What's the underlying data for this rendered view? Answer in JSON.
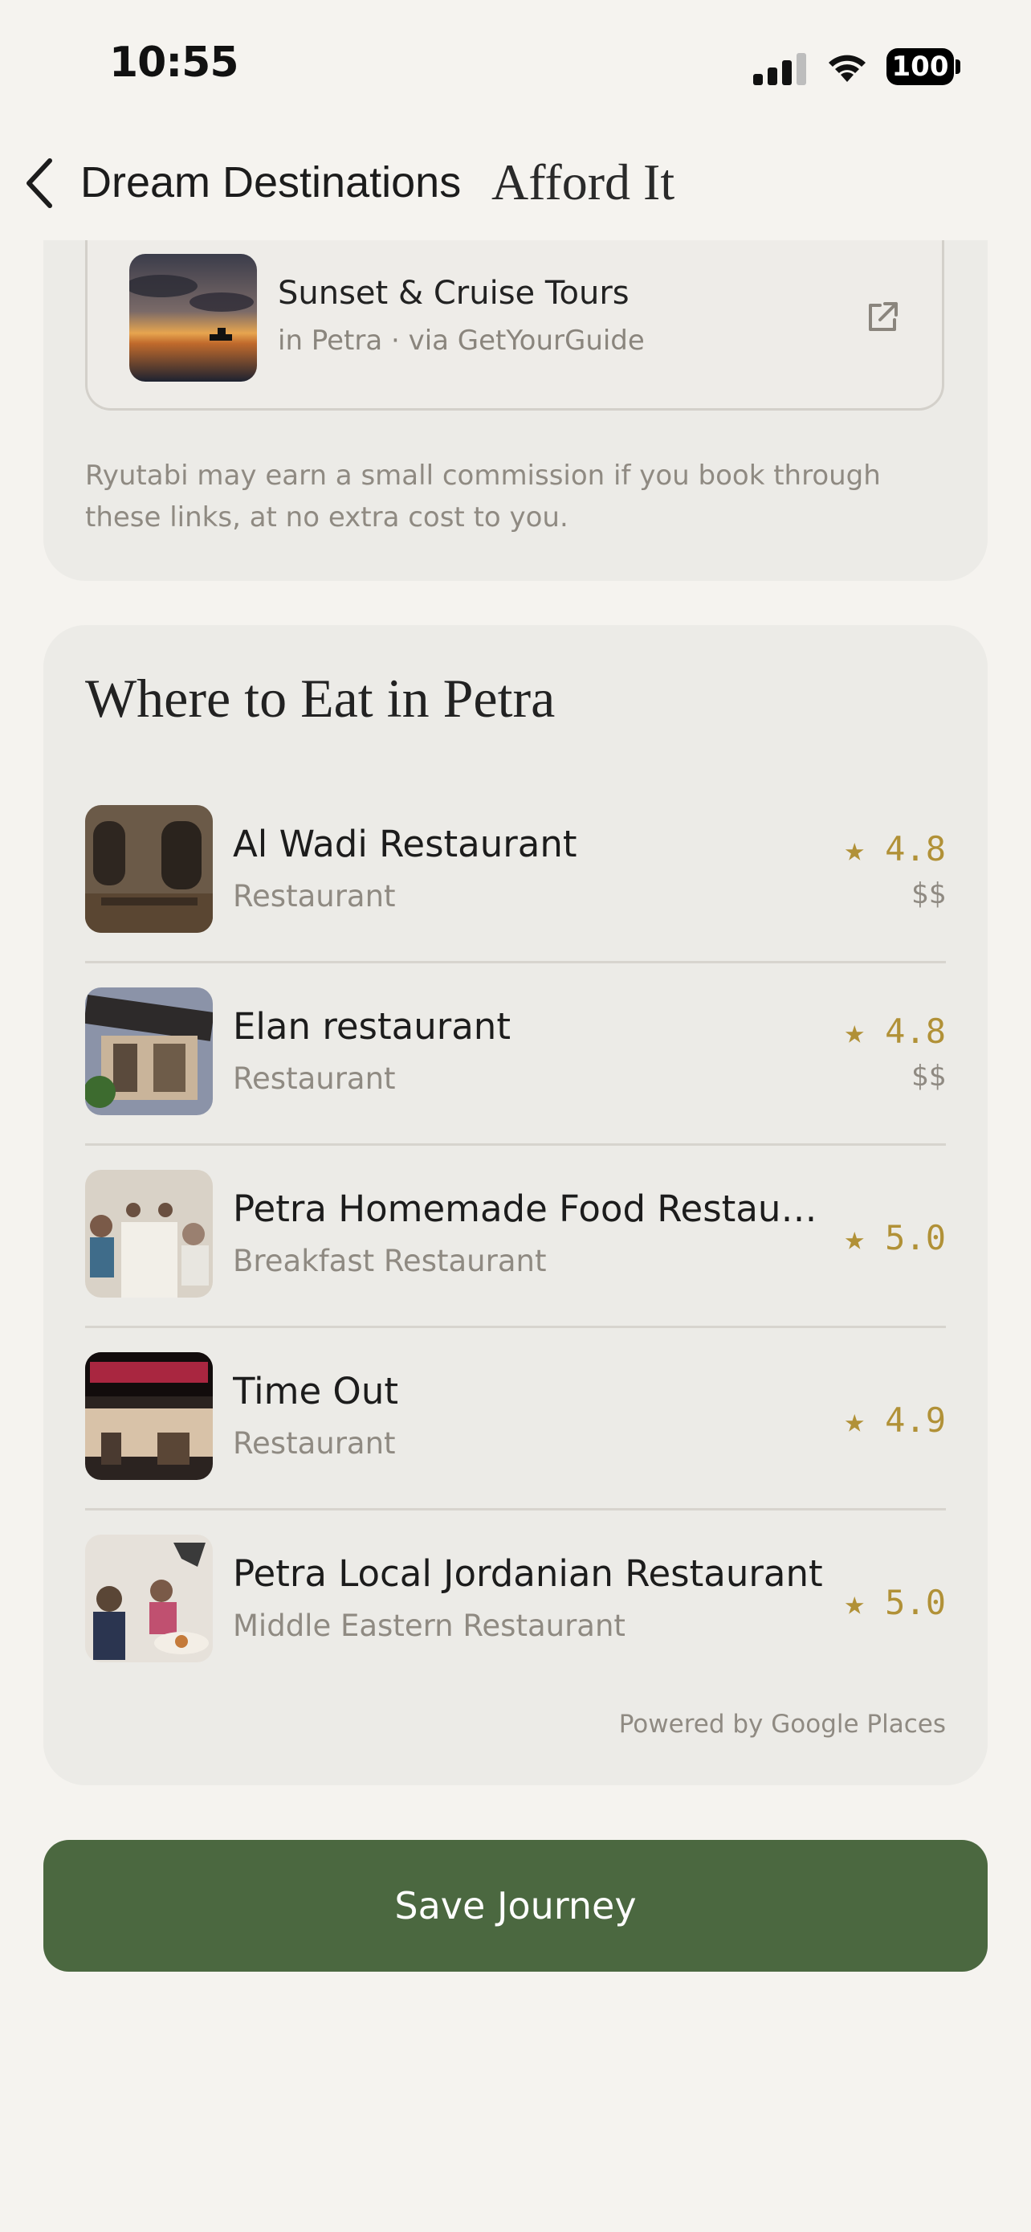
{
  "status_bar": {
    "time": "10:55",
    "battery": "100"
  },
  "nav": {
    "title": "Dream Destinations",
    "subtitle": "Afford It"
  },
  "tour": {
    "title": "Sunset & Cruise Tours",
    "subtitle": "in Petra · via GetYourGuide"
  },
  "disclaimer": "Ryutabi may earn a small commission if you book through these links, at no extra cost to you.",
  "eat": {
    "title": "Where to Eat in Petra",
    "restaurants": [
      {
        "name": "Al Wadi Restaurant",
        "category": "Restaurant",
        "rating": "★ 4.8",
        "price": "$$"
      },
      {
        "name": "Elan restaurant",
        "category": "Restaurant",
        "rating": "★ 4.8",
        "price": "$$"
      },
      {
        "name": "Petra Homemade Food Restaura...",
        "category": "Breakfast Restaurant",
        "rating": "★ 5.0",
        "price": ""
      },
      {
        "name": "Time Out",
        "category": "Restaurant",
        "rating": "★ 4.9",
        "price": ""
      },
      {
        "name": "Petra Local Jordanian Restaurant",
        "category": "Middle Eastern Restaurant",
        "rating": "★ 5.0",
        "price": ""
      }
    ],
    "powered_by": "Powered by Google Places"
  },
  "save_button": "Save Journey",
  "colors": {
    "accent": "#4b6840",
    "rating": "#b19137",
    "card": "#ecebe7",
    "background": "#f5f3ef"
  }
}
